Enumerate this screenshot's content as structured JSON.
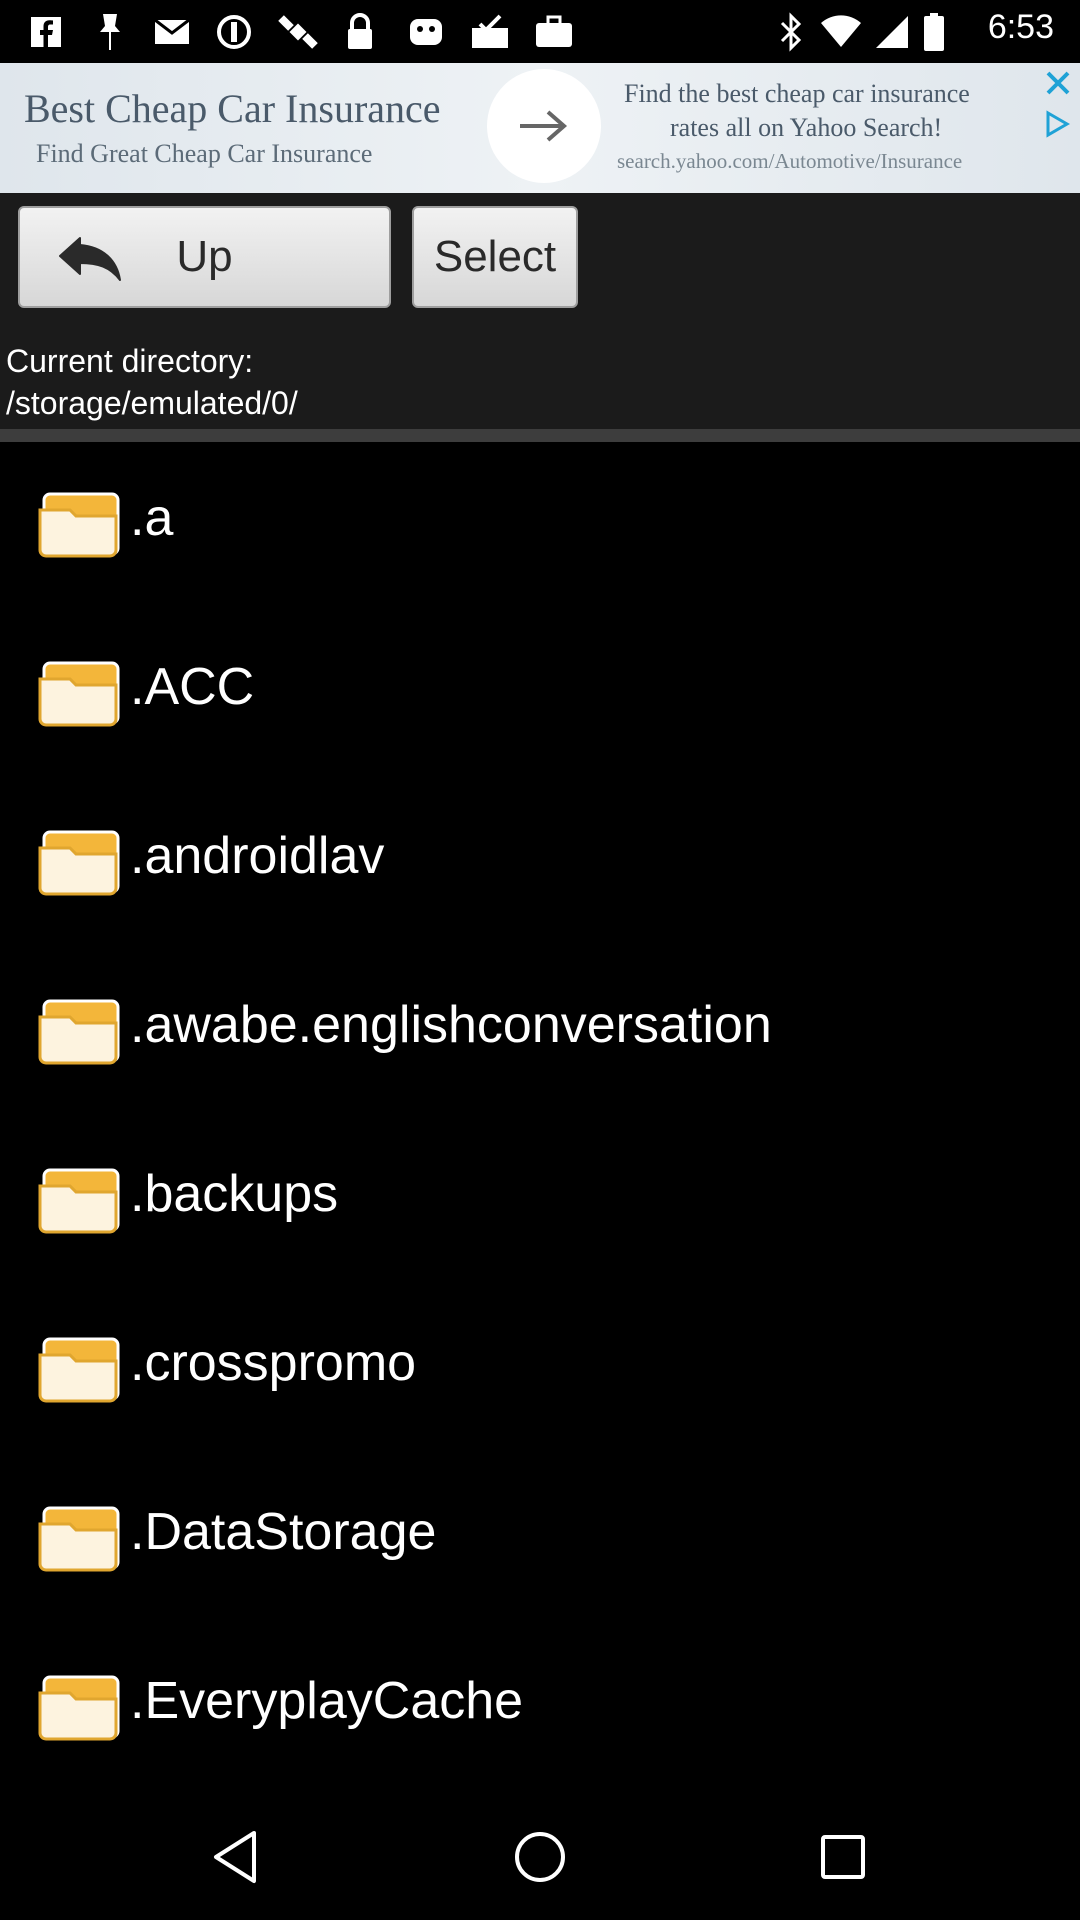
{
  "status_bar": {
    "time": "6:53",
    "left_icons": [
      "facebook-icon",
      "pin-icon",
      "mail-icon",
      "blocked-icon",
      "satellite-icon",
      "lock-icon",
      "android-icon",
      "inbox-check-icon",
      "briefcase-icon"
    ],
    "right_icons": [
      "bluetooth-icon",
      "wifi-icon",
      "signal-icon",
      "battery-icon"
    ]
  },
  "ad": {
    "title": "Best Cheap Car Insurance",
    "subtitle": "Find Great Cheap Car Insurance",
    "right_line1": "Find the best cheap car insurance",
    "right_line2": "rates all on Yahoo Search!",
    "right_url": "search.yahoo.com/Automotive/Insurance"
  },
  "toolbar": {
    "up_label": "Up",
    "select_label": "Select"
  },
  "current_directory": {
    "label": "Current directory:",
    "path": "/storage/emulated/0/"
  },
  "files": [
    {
      "name": ".a"
    },
    {
      "name": ".ACC"
    },
    {
      "name": ".androidlav"
    },
    {
      "name": ".awabe.englishconversation"
    },
    {
      "name": ".backups"
    },
    {
      "name": ".crosspromo"
    },
    {
      "name": ".DataStorage"
    },
    {
      "name": ".EveryplayCache"
    }
  ],
  "colors": {
    "folder": "#f3b63a",
    "background": "#000000",
    "toolbar": "#1b1b1b"
  }
}
